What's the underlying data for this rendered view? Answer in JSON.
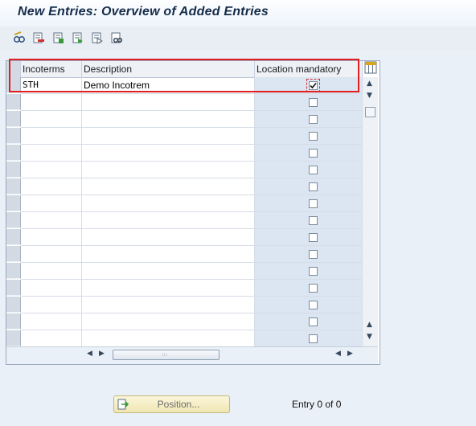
{
  "window": {
    "title": "New Entries: Overview of Added Entries"
  },
  "toolbar": {
    "icons": [
      "display-change-icon",
      "delete-icon",
      "select-all-icon",
      "select-block-icon",
      "deselect-all-icon",
      "find-icon"
    ]
  },
  "table": {
    "columns": [
      "Incoterms",
      "Description",
      "Location mandatory"
    ],
    "rows": [
      {
        "incoterms": "STH",
        "description": "Demo Incotrem",
        "location_mandatory": true
      },
      {
        "incoterms": "",
        "description": "",
        "location_mandatory": false
      },
      {
        "incoterms": "",
        "description": "",
        "location_mandatory": false
      },
      {
        "incoterms": "",
        "description": "",
        "location_mandatory": false
      },
      {
        "incoterms": "",
        "description": "",
        "location_mandatory": false
      },
      {
        "incoterms": "",
        "description": "",
        "location_mandatory": false
      },
      {
        "incoterms": "",
        "description": "",
        "location_mandatory": false
      },
      {
        "incoterms": "",
        "description": "",
        "location_mandatory": false
      },
      {
        "incoterms": "",
        "description": "",
        "location_mandatory": false
      },
      {
        "incoterms": "",
        "description": "",
        "location_mandatory": false
      },
      {
        "incoterms": "",
        "description": "",
        "location_mandatory": false
      },
      {
        "incoterms": "",
        "description": "",
        "location_mandatory": false
      },
      {
        "incoterms": "",
        "description": "",
        "location_mandatory": false
      },
      {
        "incoterms": "",
        "description": "",
        "location_mandatory": false
      },
      {
        "incoterms": "",
        "description": "",
        "location_mandatory": false
      },
      {
        "incoterms": "",
        "description": "",
        "location_mandatory": false
      }
    ]
  },
  "footer": {
    "position_button": "Position...",
    "entry_text": "Entry 0 of 0"
  },
  "colors": {
    "highlight": "#e02020",
    "title_text": "#142c4a"
  }
}
